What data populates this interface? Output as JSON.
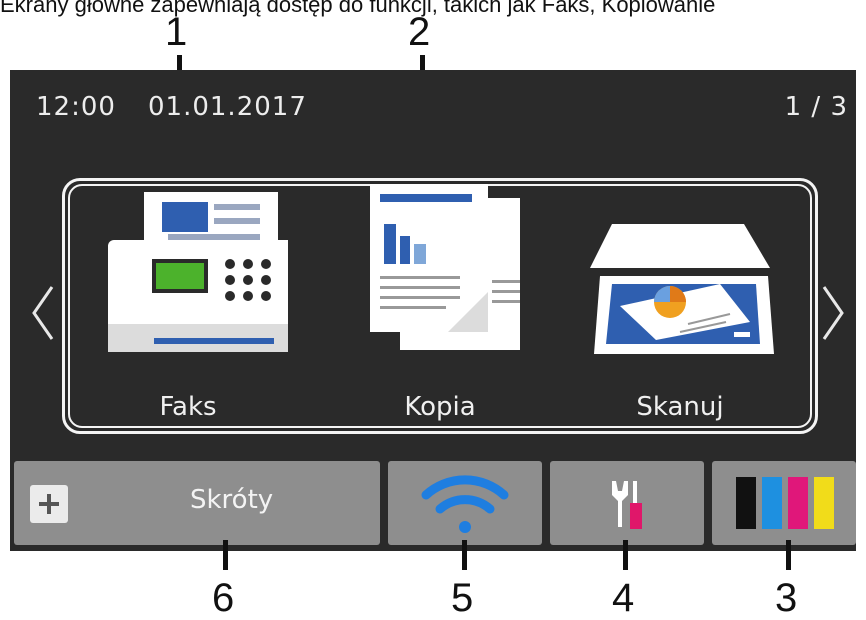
{
  "caption": "Ekrany główne zapewniają dostęp do funkcji, takich jak Faks, Kopiowanie",
  "status": {
    "time": "12:00",
    "date": "01.01.2017",
    "page": "1 / 3"
  },
  "functions": [
    {
      "label": "Faks",
      "icon": "fax-icon"
    },
    {
      "label": "Kopia",
      "icon": "copy-icon"
    },
    {
      "label": "Skanuj",
      "icon": "scanner-icon"
    }
  ],
  "bottom_bar": {
    "shortcuts_label": "Skróty",
    "shortcuts_icon": "plus-icon",
    "wifi_icon": "wifi-icon",
    "settings_icon": "wrench-screwdriver-icon",
    "toner_icon": "toner-icon",
    "toner_colors": [
      "#111111",
      "#1e90e0",
      "#e0177a",
      "#f1dc1a"
    ]
  },
  "callouts": [
    "1",
    "2",
    "3",
    "4",
    "5",
    "6"
  ]
}
